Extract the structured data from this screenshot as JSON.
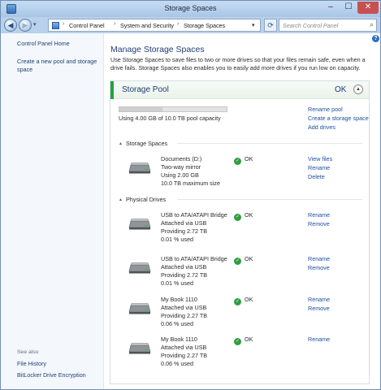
{
  "window": {
    "title": "Storage Spaces",
    "minimize": "–",
    "maximize": "☐",
    "close": "✕"
  },
  "address": {
    "breadcrumbs": [
      "Control Panel",
      "System and Security",
      "Storage Spaces"
    ],
    "search_placeholder": "Search Control Panel"
  },
  "sidebar": {
    "links": [
      "Control Panel Home",
      "Create a new pool and storage space"
    ],
    "see_also_label": "See also",
    "see_also": [
      "File History",
      "BitLocker Drive Encryption"
    ]
  },
  "main": {
    "title": "Manage Storage Spaces",
    "intro": "Use Storage Spaces to save files to two or more drives so that your files remain safe, even when a drive fails. Storage Spaces also enables you to easily add more drives if you run low on capacity."
  },
  "pool": {
    "name": "Storage Pool",
    "status": "OK",
    "used_fraction": 0.4,
    "capacity_text": "Using 4.00 GB of 10.0 TB pool capacity",
    "actions": [
      "Rename pool",
      "Create a storage space",
      "Add drives"
    ]
  },
  "storage_spaces": {
    "heading": "Storage Spaces",
    "items": [
      {
        "lines": [
          "Documents (D:)",
          "Two-way mirror",
          "Using 2.00 GB",
          "10.0 TB maximum size"
        ],
        "status": "OK",
        "actions": [
          "View files",
          "Rename",
          "Delete"
        ]
      }
    ]
  },
  "physical_drives": {
    "heading": "Physical Drives",
    "items": [
      {
        "lines": [
          "USB to ATA/ATAPI Bridge",
          "Attached via USB",
          "Providing 2.72 TB",
          "0.01 % used"
        ],
        "status": "OK",
        "actions": [
          "Rename",
          "Remove"
        ]
      },
      {
        "lines": [
          "USB to ATA/ATAPI Bridge",
          "Attached via USB",
          "Providing 2.72 TB",
          "0.01 % used"
        ],
        "status": "OK",
        "actions": [
          "Rename",
          "Remove"
        ]
      },
      {
        "lines": [
          "My Book 1110",
          "Attached via USB",
          "Providing 2.27 TB",
          "0.06 % used"
        ],
        "status": "OK",
        "actions": [
          "Rename",
          "Remove"
        ]
      },
      {
        "lines": [
          "My Book 1110",
          "Attached via USB",
          "Providing 2.27 TB",
          "0.06 % used"
        ],
        "status": "OK",
        "actions": [
          "Rename"
        ]
      }
    ]
  }
}
